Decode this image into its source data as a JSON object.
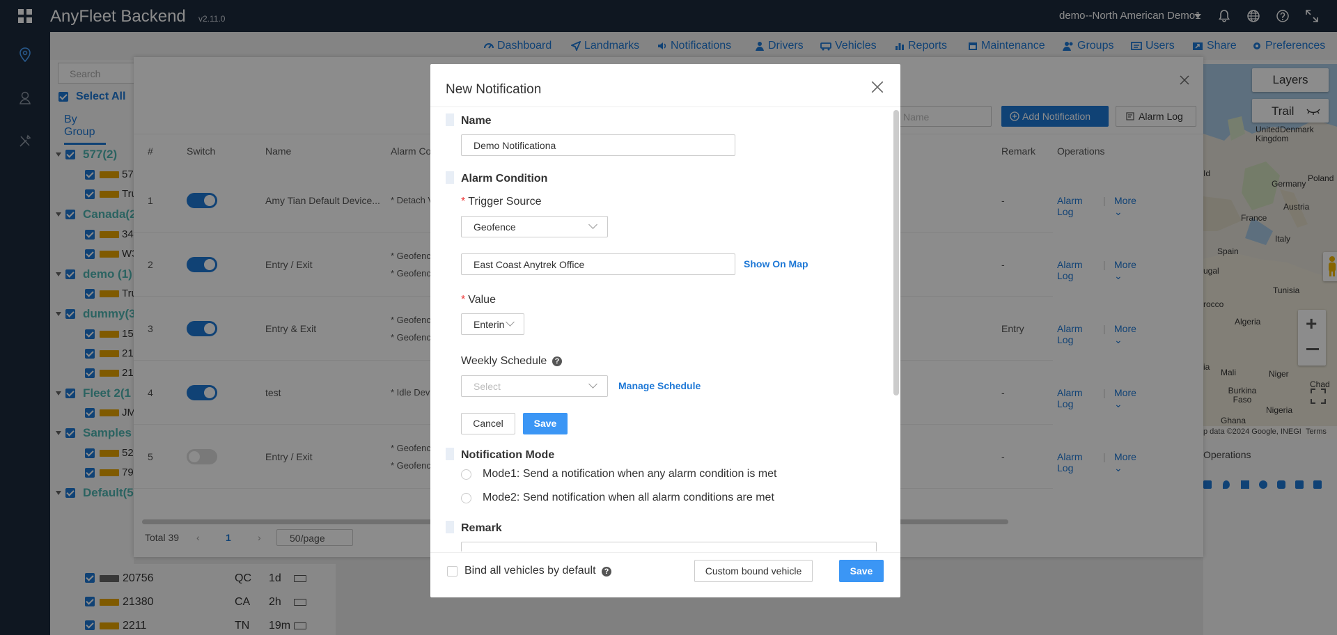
{
  "topbar": {
    "brand": "AnyFleet Backend",
    "version": "v2.11.0",
    "account": "demo--North American Demo1"
  },
  "menu": {
    "items": [
      "Dashboard",
      "Landmarks",
      "Notifications",
      "Drivers",
      "Vehicles",
      "Reports",
      "Maintenance",
      "Groups",
      "Users",
      "Share",
      "Preferences"
    ]
  },
  "tree": {
    "search_placeholder": "Search",
    "select_all": "Select All",
    "tab": "By Group",
    "rows": [
      {
        "type": "group",
        "label": "577(2)"
      },
      {
        "type": "item",
        "label": "57"
      },
      {
        "type": "item",
        "label": "Tru"
      },
      {
        "type": "group",
        "label": "Canada(2"
      },
      {
        "type": "item",
        "label": "34"
      },
      {
        "type": "item",
        "label": "W3"
      },
      {
        "type": "group",
        "label": "demo (1)"
      },
      {
        "type": "item",
        "label": "Tru"
      },
      {
        "type": "group",
        "label": "dummy(3"
      },
      {
        "type": "item",
        "label": "15"
      },
      {
        "type": "item",
        "label": "21"
      },
      {
        "type": "item",
        "label": "21"
      },
      {
        "type": "group",
        "label": "Fleet 2(1"
      },
      {
        "type": "item",
        "label": "JM"
      },
      {
        "type": "group",
        "label": "Samples"
      },
      {
        "type": "item",
        "label": "52"
      },
      {
        "type": "item",
        "label": "79"
      },
      {
        "type": "group",
        "label": "Default(5"
      }
    ],
    "bottom_rows": [
      {
        "id": "20756",
        "state": "QC",
        "age": "1d"
      },
      {
        "id": "21380",
        "state": "CA",
        "age": "2h"
      },
      {
        "id": "2211",
        "state": "TN",
        "age": "19m"
      }
    ]
  },
  "panel": {
    "search_placeholder": "Name",
    "add_button": "Add Notification",
    "alarm_log_button": "Alarm Log",
    "columns": {
      "num": "#",
      "switch": "Switch",
      "name": "Name",
      "alarm": "Alarm Co",
      "remark": "Remark",
      "ops": "Operations"
    },
    "rows": [
      {
        "n": "1",
        "on": true,
        "name": "Amy Tian Default Device...",
        "alarm": [
          "* Detach V"
        ],
        "remark": "-"
      },
      {
        "n": "2",
        "on": true,
        "name": "Entry / Exit",
        "alarm": [
          "* Geofenc",
          "* Geofenc"
        ],
        "remark": "-"
      },
      {
        "n": "3",
        "on": true,
        "name": "Entry & Exit",
        "alarm": [
          "* Geofenc",
          "* Geofenc"
        ],
        "remark": "Entry"
      },
      {
        "n": "4",
        "on": true,
        "name": "test",
        "alarm": [
          "* Idle Dev"
        ],
        "remark": "-"
      },
      {
        "n": "5",
        "on": false,
        "name": "Entry / Exit",
        "alarm": [
          "* Geofenc",
          "* Geofenc"
        ],
        "remark": "-"
      }
    ],
    "op_alarm_log": "Alarm Log",
    "op_more": "More",
    "total": "Total 39",
    "page": "1",
    "per_page": "50/page"
  },
  "map": {
    "layers": "Layers",
    "trail": "Trail",
    "labels": [
      "United Kingdom",
      "Denmark",
      "Poland",
      "Germany",
      "Austria",
      "France",
      "Italy",
      "Spain",
      "Tunisia",
      "Algeria",
      "Mali",
      "Niger",
      "Chad",
      "Burkina Faso",
      "Nigeria",
      "Ghana",
      "rocco",
      "ugal",
      "ia",
      "Id"
    ],
    "attribution": "p data ©2024 Google, INEGI",
    "terms": "Terms",
    "operations": "Operations"
  },
  "modal": {
    "title": "New Notification",
    "name_section": "Name",
    "name_value": "Demo Notificationa",
    "alarm_section": "Alarm Condition",
    "trigger_label": "Trigger Source",
    "trigger_value": "Geofence",
    "geofence_value": "East Coast Anytrek Office",
    "show_on_map": "Show On Map",
    "value_label": "Value",
    "value_value": "Enterin",
    "schedule_label": "Weekly Schedule",
    "schedule_placeholder": "Select",
    "manage_schedule": "Manage Schedule",
    "cancel": "Cancel",
    "save_inner": "Save",
    "mode_section": "Notification Mode",
    "mode1": "Mode1: Send a notification when any alarm condition is met",
    "mode2": "Mode2: Send notification when all alarm conditions are met",
    "remark_section": "Remark",
    "bind_all": "Bind all vehicles by default",
    "custom_bound": "Custom bound vehicle",
    "save": "Save"
  }
}
